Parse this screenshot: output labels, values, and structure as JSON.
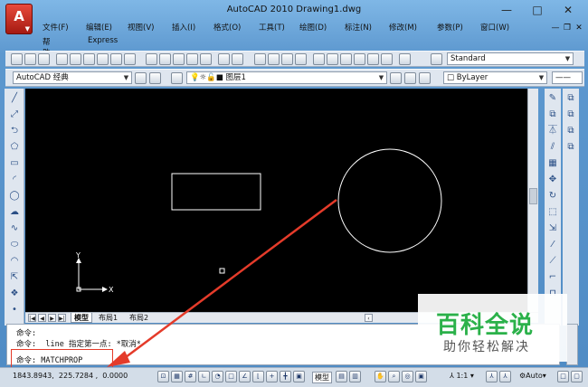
{
  "window": {
    "title": "AutoCAD 2010     Drawing1.dwg",
    "app_letter": "A",
    "controls": [
      "—",
      "□",
      "✕"
    ]
  },
  "menu": {
    "items": [
      "文件(F)",
      "编辑(E)",
      "视图(V)",
      "插入(I)",
      "格式(O)",
      "工具(T)",
      "绘图(D)",
      "标注(N)",
      "修改(M)",
      "参数(P)",
      "窗口(W)"
    ],
    "row2": [
      "帮助(H)",
      "Express"
    ]
  },
  "toolbar": {
    "style_combo": "Standard",
    "workspace_combo": "AutoCAD 经典",
    "layer_combo": "图层1",
    "color_combo": "ByLayer"
  },
  "ucs": {
    "x_label": "X",
    "y_label": "Y"
  },
  "layout_tabs": [
    "模型",
    "布局1",
    "布局2"
  ],
  "command": {
    "line1": "命令:",
    "line2": "命令:  line 指定第一点: *取消*",
    "line3": "命令: MATCHPROP"
  },
  "status": {
    "coords": "1843.8943,  225.7284 ,  0.0000",
    "model_label": "模型",
    "scale_label": "1:1",
    "auto_label": "Auto"
  },
  "watermark": {
    "title": "百科全说",
    "subtitle": "助你轻松解决"
  },
  "colors": {
    "canvas_bg": "#000000",
    "annotation_arrow": "#e43b2a",
    "watermark_green": "#2bb14a"
  }
}
